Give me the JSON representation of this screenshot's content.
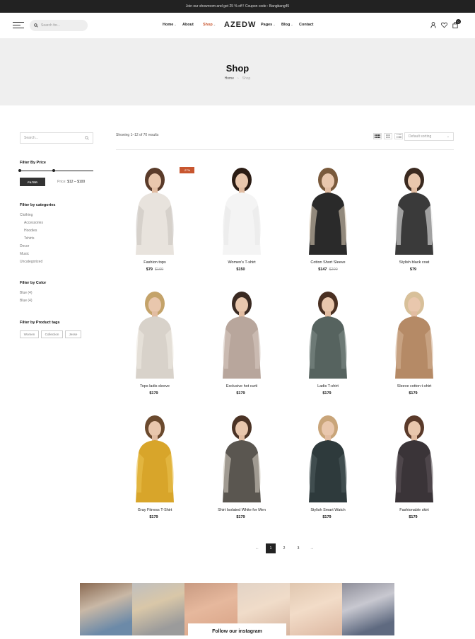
{
  "topbar": {
    "text": "Join our showroom and get 25 % off ! Coupon code : Bangbang45"
  },
  "header": {
    "search_placeholder": "Search for...",
    "nav_left": [
      "Home",
      "About",
      "Shop"
    ],
    "logo": "AZEDW",
    "nav_right": [
      "Pages",
      "Blog",
      "Contact"
    ],
    "cart_count": "0"
  },
  "hero": {
    "title": "Shop",
    "breadcrumb": [
      "Home",
      "Shop"
    ]
  },
  "sidebar": {
    "search_placeholder": "Search...",
    "price_heading": "Filter By Price",
    "filter_button": "FILTER",
    "price_label": "Price:",
    "price_range": "$12 – $100",
    "categories_heading": "Filter by categories",
    "categories": [
      "Clothing",
      "Accessories",
      "Hoodies",
      "Tshirts",
      "Decor",
      "Music",
      "Uncategorized"
    ],
    "color_heading": "Filter by Color",
    "colors": [
      "Blue (4)",
      "Blue (4)"
    ],
    "tags_heading": "Filter by Product tags",
    "tags": [
      "Women",
      "Collection",
      "Jesse"
    ]
  },
  "toolbar": {
    "results": "Showing 1–12 of 70 results",
    "sorting": "Default sorting"
  },
  "products": [
    {
      "name": "Fashion tops",
      "price": "$79",
      "old_price": "$109",
      "sale": "-27%"
    },
    {
      "name": "Women's T-shirt",
      "price": "$150",
      "old_price": ""
    },
    {
      "name": "Cotton Short Sleeve",
      "price": "$147",
      "old_price": "$200"
    },
    {
      "name": "Stylish black coat",
      "price": "$79",
      "old_price": ""
    },
    {
      "name": "Tops ladis sleeve",
      "price": "$179",
      "old_price": ""
    },
    {
      "name": "Exclusive hot curti",
      "price": "$179",
      "old_price": ""
    },
    {
      "name": "Ladis T-shirt",
      "price": "$179",
      "old_price": ""
    },
    {
      "name": "Sleeve cotton t-shirt",
      "price": "$179",
      "old_price": ""
    },
    {
      "name": "Gray Fitness T-Shirt",
      "price": "$179",
      "old_price": ""
    },
    {
      "name": "Shirt Isolated White for Men",
      "price": "$179",
      "old_price": ""
    },
    {
      "name": "Stylish Smart Watch",
      "price": "$179",
      "old_price": ""
    },
    {
      "name": "Fashionable skirt",
      "price": "$179",
      "old_price": ""
    }
  ],
  "pagination": {
    "prev": "←",
    "pages": [
      "1",
      "2",
      "3"
    ],
    "next": "→"
  },
  "instagram": {
    "title": "Follow our instagram"
  },
  "colors": {
    "accent": "#c8562f",
    "dark": "#222222",
    "hero_bg": "#efefef"
  }
}
